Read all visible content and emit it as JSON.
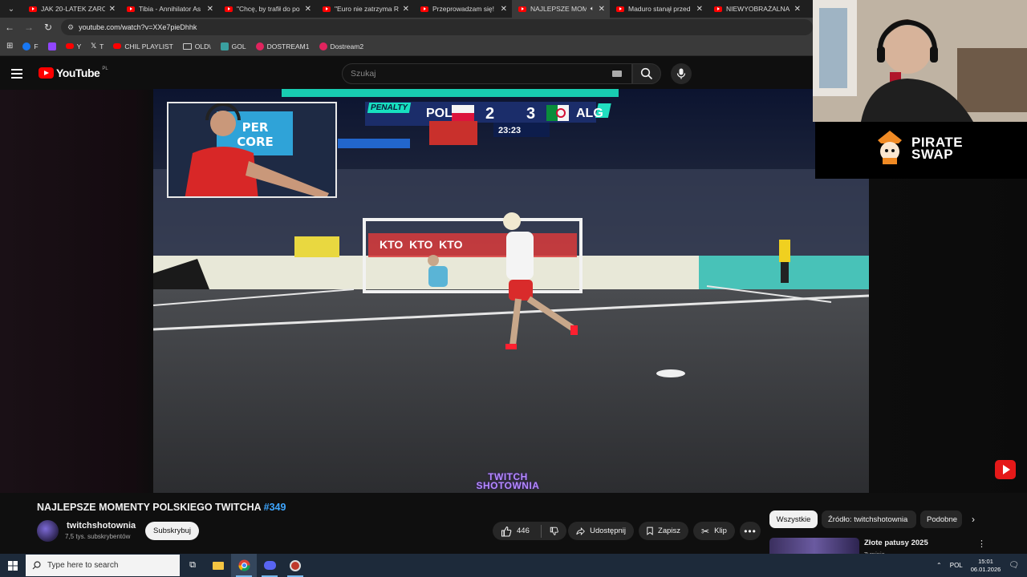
{
  "browser": {
    "tabs": [
      {
        "title": "JAK 20-LATEK ZAROB",
        "active": false
      },
      {
        "title": "Tibia - Annihilator As",
        "active": false
      },
      {
        "title": "\"Chcę, by trafił do po",
        "active": false
      },
      {
        "title": "\"Euro nie zatrzyma Ro",
        "active": false
      },
      {
        "title": "Przeprowadzam się! I",
        "active": false
      },
      {
        "title": "NAJLEPSZE MOM",
        "active": true
      },
      {
        "title": "Maduro stanął przed",
        "active": false
      },
      {
        "title": "NIEWYOBRAŻALNA S",
        "active": false
      }
    ],
    "url": "youtube.com/watch?v=XXe7pieDhhk",
    "bookmarks": [
      {
        "label": "F",
        "color": "#1877f2"
      },
      {
        "label": "",
        "color": "#9146ff"
      },
      {
        "label": "Y",
        "color": "#ff0000"
      },
      {
        "label": "T",
        "color": "#000000"
      },
      {
        "label": "CHIL PLAYLIST",
        "color": "#ff0000"
      },
      {
        "label": "OLD\\",
        "color": "folder"
      },
      {
        "label": "GOL",
        "color": "#3aa0a0"
      },
      {
        "label": "DOSTREAM1",
        "color": "#e0245e"
      },
      {
        "label": "Dostream2",
        "color": "#e0245e"
      }
    ]
  },
  "youtube": {
    "logo_text": "YouTube",
    "country_code": "PL",
    "search_placeholder": "Szukaj"
  },
  "video": {
    "scoreboard": {
      "tag": "PENALTY",
      "team1": "POL",
      "score1": "2",
      "score2": "3",
      "team2": "ALG",
      "clock": "23:23"
    },
    "ad_banner_text": "KTO  KTO  KTO",
    "watermark_line1": "TWITCH",
    "watermark_line2": "SHOTOWNIA",
    "title_main": "NAJLEPSZE MOMENTY POLSKIEGO TWITCHA ",
    "title_tag": "#349"
  },
  "channel": {
    "name": "twitchshotownia",
    "subscribers": "7,5 tys. subskrybentów",
    "subscribe_label": "Subskrybuj"
  },
  "actions": {
    "likes": "446",
    "share": "Udostępnij",
    "save": "Zapisz",
    "clip": "Klip"
  },
  "chips": {
    "all": "Wszystkie",
    "source": "Źródło: twitchshotownia",
    "similar": "Podobne"
  },
  "recommendation": {
    "title": "Złote patusy 2025",
    "channel": "Tymipio"
  },
  "sponsor": {
    "line1": "PIRATE",
    "line2": "SWAP"
  },
  "taskbar": {
    "search_placeholder": "Type here to search",
    "language": "POL",
    "time": "15:01",
    "date": "06.01.2026"
  }
}
